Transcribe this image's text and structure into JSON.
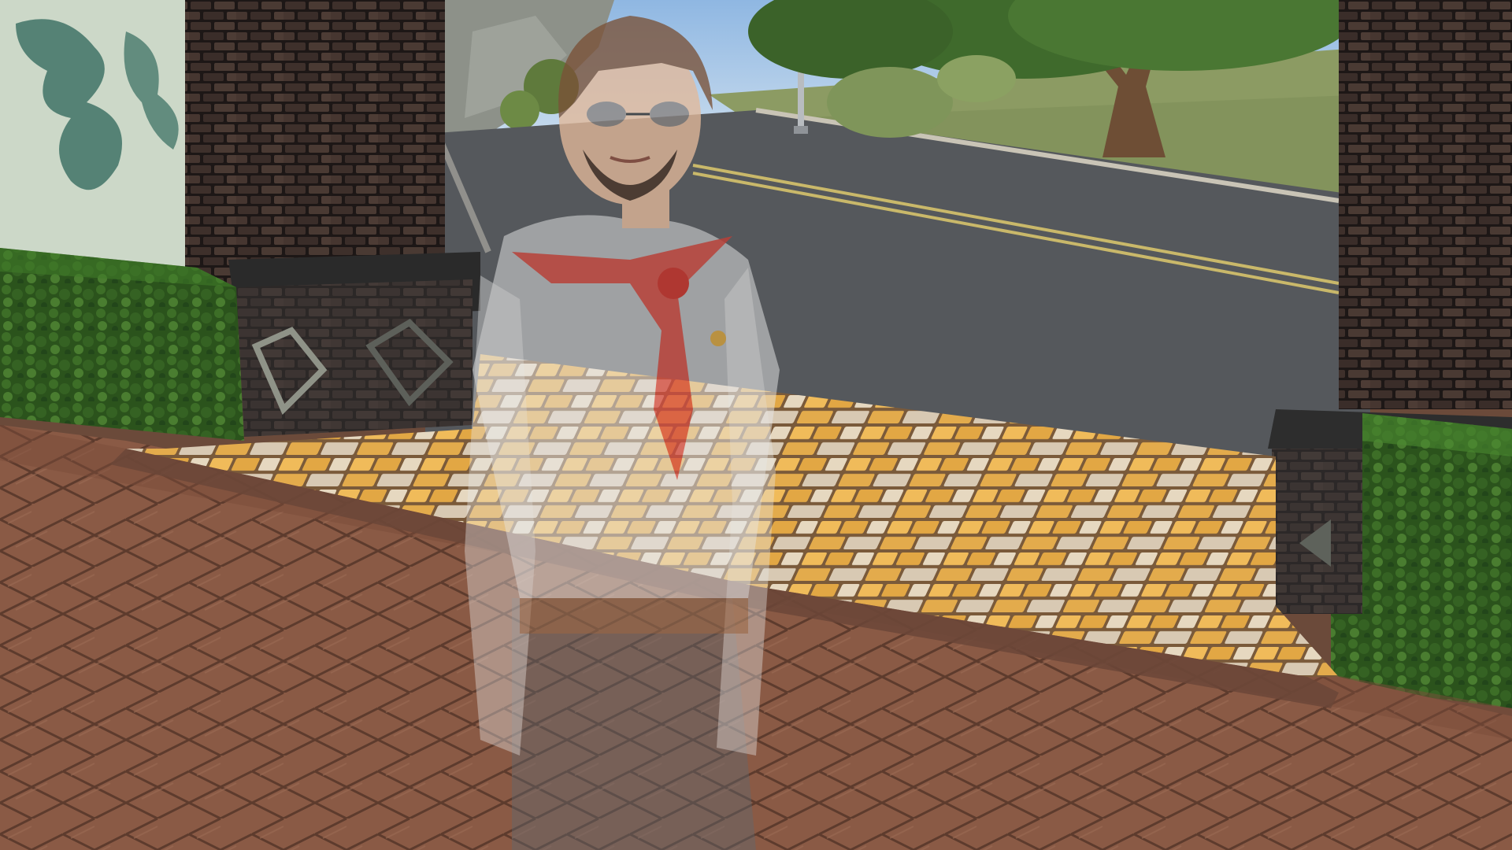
{
  "scene": {
    "description_free": true,
    "layers": [
      "sky",
      "hillside",
      "grass-lawn",
      "street",
      "tree",
      "street-lamp",
      "shrubs",
      "left-wall",
      "left-pillar",
      "right-pillar",
      "hedge-left",
      "hedge-right",
      "herringbone-pavement",
      "yellow-brick-path",
      "ghost-character"
    ]
  },
  "colors": {
    "sky": "#9fc3e6",
    "hill": "#8a8f86",
    "grass": "#8a9a62",
    "street": "#55585c",
    "street_line": "#c9b86a",
    "curb": "#c8c4b8",
    "tree_trunk": "#6e4e35",
    "foliage": "#3f6a2c",
    "wall_plaster": "#c9d6c6",
    "wall_shadow": "#3f7366",
    "brick_dark": "#3b2e2a",
    "brick_mortar": "#1f1918",
    "pillar_base": "#2c2c2c",
    "hedge": "#2f5a1e",
    "pavement": "#8a5a45",
    "pavement_line": "#5a3a2c",
    "path_yellow": "#e0a84a",
    "path_light": "#d9cbb6",
    "ghost_shirt": "#e8e8e8",
    "ghost_scarf": "#d33a2e",
    "ghost_pants": "#5f6770",
    "ghost_hair": "#7a5238",
    "ghost_skin": "#e2b99a"
  }
}
